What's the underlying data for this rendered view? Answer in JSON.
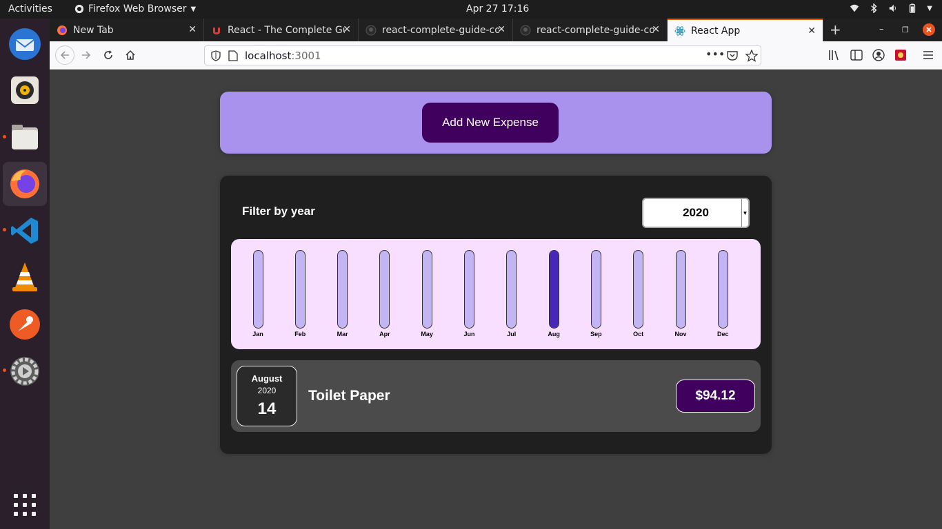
{
  "topbar": {
    "activities": "Activities",
    "app_menu": "Firefox Web Browser",
    "clock": "Apr 27  17:16"
  },
  "dock": {
    "items": [
      "thunderbird-icon",
      "rhythmbox-icon",
      "files-icon",
      "firefox-icon",
      "vscode-icon",
      "vlc-icon",
      "postman-icon",
      "settings-icon",
      "app-grid-icon"
    ]
  },
  "browser": {
    "tabs": [
      {
        "title": "New Tab",
        "active": false
      },
      {
        "title": "React - The Complete Gu",
        "active": false
      },
      {
        "title": "react-complete-guide-co",
        "active": false
      },
      {
        "title": "react-complete-guide-co",
        "active": false
      },
      {
        "title": "React App",
        "active": true
      }
    ],
    "url_host": "localhost",
    "url_port": ":3001"
  },
  "new_expense": {
    "button_label": "Add New Expense"
  },
  "filter": {
    "label": "Filter by year",
    "selected_year": "2020"
  },
  "chart_data": {
    "type": "bar",
    "categories": [
      "Jan",
      "Feb",
      "Mar",
      "Apr",
      "May",
      "Jun",
      "Jul",
      "Aug",
      "Sep",
      "Oct",
      "Nov",
      "Dec"
    ],
    "fill_fraction": [
      0,
      0,
      0,
      0,
      0,
      0,
      0,
      1,
      0,
      0,
      0,
      0
    ],
    "colors": {
      "empty": "#c3b4f3",
      "fill": "#4826b9"
    }
  },
  "expense_item": {
    "month": "August",
    "year": "2020",
    "day": "14",
    "title": "Toilet Paper",
    "amount": "$94.12"
  },
  "colors": {
    "accent": "#40005d",
    "form_bg": "#a892ee",
    "chart_bg": "#f8dfff"
  }
}
